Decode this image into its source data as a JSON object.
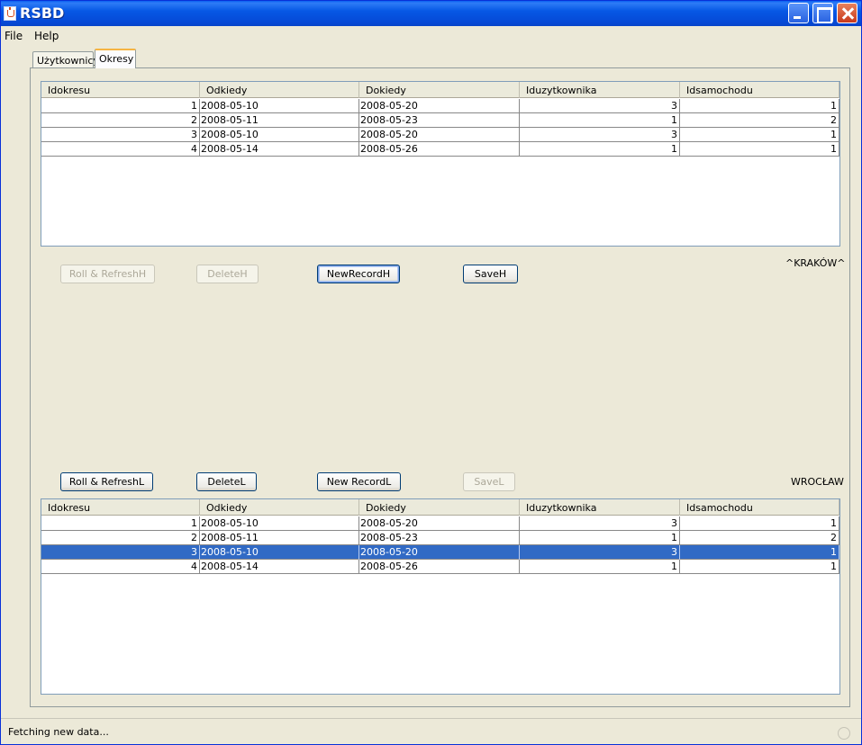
{
  "window": {
    "title": "RSBD"
  },
  "menu": [
    {
      "label": "File"
    },
    {
      "label": "Help"
    }
  ],
  "tabs": [
    {
      "label": "Użytkownicy"
    },
    {
      "label": "Okresy"
    }
  ],
  "columns": [
    "Idokresu",
    "Odkiedy",
    "Dokiedy",
    "Iduzytkownika",
    "Idsamochodu"
  ],
  "top_table": {
    "rows": [
      [
        "1",
        "2008-05-10",
        "2008-05-20",
        "3",
        "1"
      ],
      [
        "2",
        "2008-05-11",
        "2008-05-23",
        "1",
        "2"
      ],
      [
        "3",
        "2008-05-10",
        "2008-05-20",
        "3",
        "1"
      ],
      [
        "4",
        "2008-05-14",
        "2008-05-26",
        "1",
        "1"
      ]
    ]
  },
  "top_buttons": {
    "roll_refresh": "Roll & RefreshH",
    "delete": "DeleteH",
    "new_record": "NewRecordH",
    "save": "SaveH"
  },
  "top_city": "^KRAKÓW^",
  "bottom_buttons": {
    "roll_refresh": "Roll & RefreshL",
    "delete": "DeleteL",
    "new_record": "New RecordL",
    "save": "SaveL"
  },
  "bottom_city": "WROCŁAW",
  "bottom_table": {
    "selected_row_index": 2,
    "rows": [
      [
        "1",
        "2008-05-10",
        "2008-05-20",
        "3",
        "1"
      ],
      [
        "2",
        "2008-05-11",
        "2008-05-23",
        "1",
        "2"
      ],
      [
        "3",
        "2008-05-10",
        "2008-05-20",
        "3",
        "1"
      ],
      [
        "4",
        "2008-05-14",
        "2008-05-26",
        "1",
        "1"
      ]
    ]
  },
  "status": {
    "text": "Fetching new data..."
  },
  "colors": {
    "selection": "#316ac5",
    "titlebar": "#0758e5",
    "tab_highlight": "#f6b442"
  }
}
